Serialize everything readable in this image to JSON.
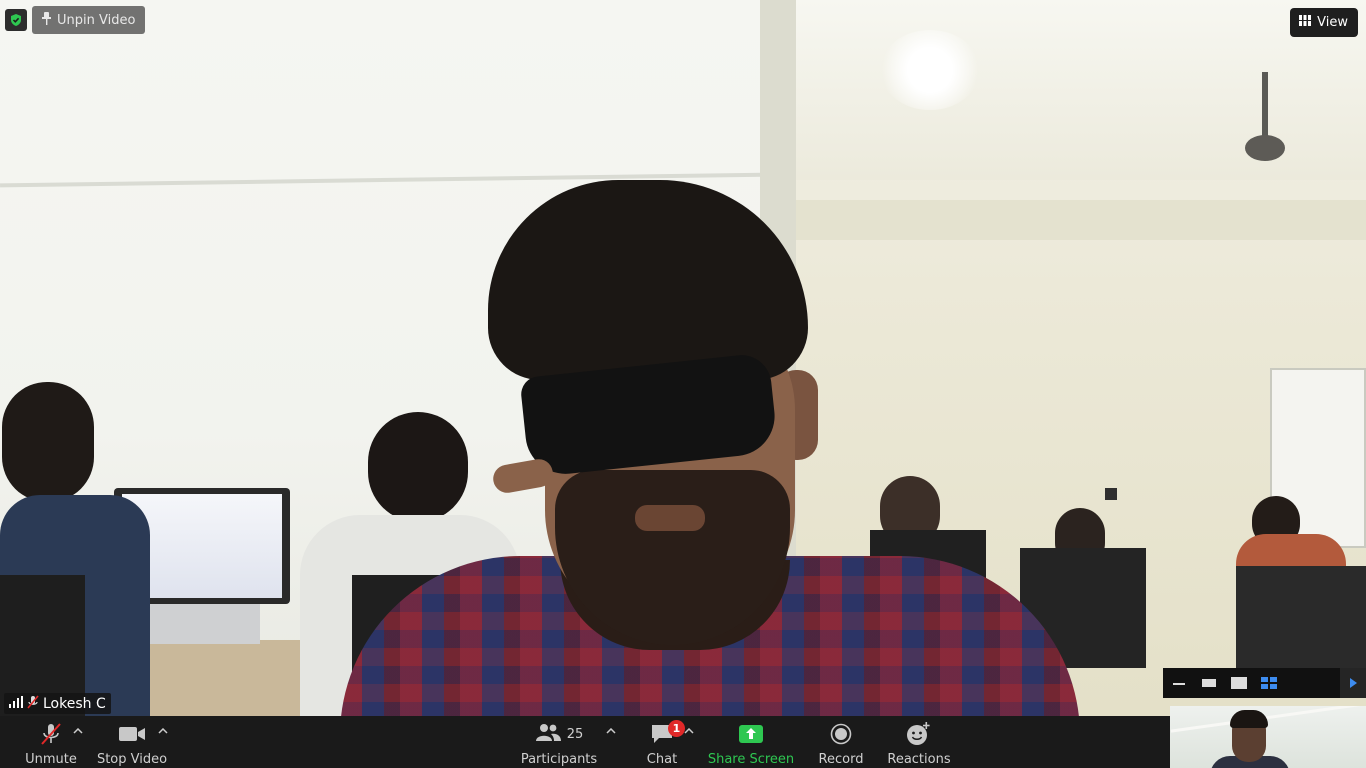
{
  "meeting": {
    "unpin_label": "Unpin Video",
    "view_label": "View",
    "speaker_name": "Lokesh C"
  },
  "toolbar": {
    "unmute_label": "Unmute",
    "stop_video_label": "Stop Video",
    "participants_label": "Participants",
    "participants_count": "25",
    "chat_label": "Chat",
    "chat_unread": "1",
    "share_screen_label": "Share Screen",
    "record_label": "Record",
    "reactions_label": "Reactions"
  },
  "colors": {
    "accent_green": "#2ec751",
    "badge_red": "#e02828",
    "toolbar_bg": "#1a1a1a",
    "active_view_blue": "#3d8cf0"
  },
  "icons": {
    "shield": "shield-check-icon",
    "pin": "pin-icon",
    "view": "grid-view-icon",
    "signal": "signal-bars-icon",
    "mic_muted": "mic-muted-icon",
    "mic": "mic-off-icon",
    "video": "video-camera-icon",
    "participants": "participants-icon",
    "chat": "chat-bubble-icon",
    "share": "share-screen-icon",
    "record": "record-icon",
    "reactions": "reactions-icon"
  }
}
